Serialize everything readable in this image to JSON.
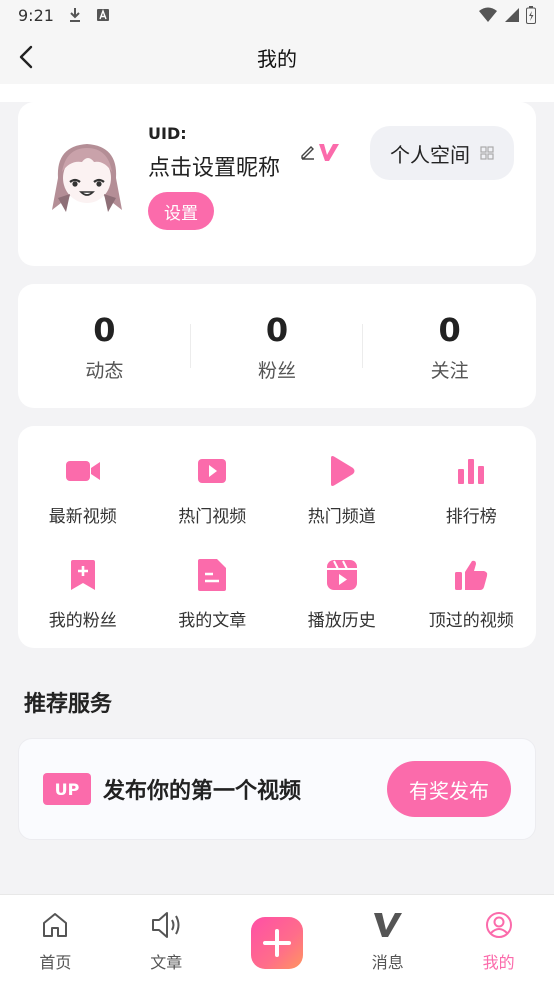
{
  "status_bar": {
    "time": "9:21"
  },
  "header": {
    "title": "我的"
  },
  "profile": {
    "uid_label": "UID:",
    "nickname": "点击设置昵称",
    "settings_label": "设置",
    "space_label": "个人空间"
  },
  "stats": [
    {
      "value": "0",
      "label": "动态"
    },
    {
      "value": "0",
      "label": "粉丝"
    },
    {
      "value": "0",
      "label": "关注"
    }
  ],
  "menu": [
    {
      "label": "最新视频",
      "icon": "video-camera-icon"
    },
    {
      "label": "热门视频",
      "icon": "play-box-icon"
    },
    {
      "label": "热门频道",
      "icon": "play-triangle-icon"
    },
    {
      "label": "排行榜",
      "icon": "bar-chart-icon"
    },
    {
      "label": "我的粉丝",
      "icon": "bookmark-plus-icon"
    },
    {
      "label": "我的文章",
      "icon": "document-icon"
    },
    {
      "label": "播放历史",
      "icon": "clapperboard-icon"
    },
    {
      "label": "顶过的视频",
      "icon": "thumbs-up-icon"
    }
  ],
  "recommend": {
    "title": "推荐服务",
    "tag": "UP",
    "text": "发布你的第一个视频",
    "button": "有奖发布"
  },
  "tabs": [
    {
      "label": "首页",
      "icon": "home-icon"
    },
    {
      "label": "文章",
      "icon": "speaker-icon"
    },
    {
      "label": "",
      "icon": "plus-icon"
    },
    {
      "label": "消息",
      "icon": "v-logo-icon"
    },
    {
      "label": "我的",
      "icon": "user-circle-icon"
    }
  ],
  "colors": {
    "accent": "#fb6bab",
    "background": "#f3f3f5",
    "card": "#ffffff"
  }
}
